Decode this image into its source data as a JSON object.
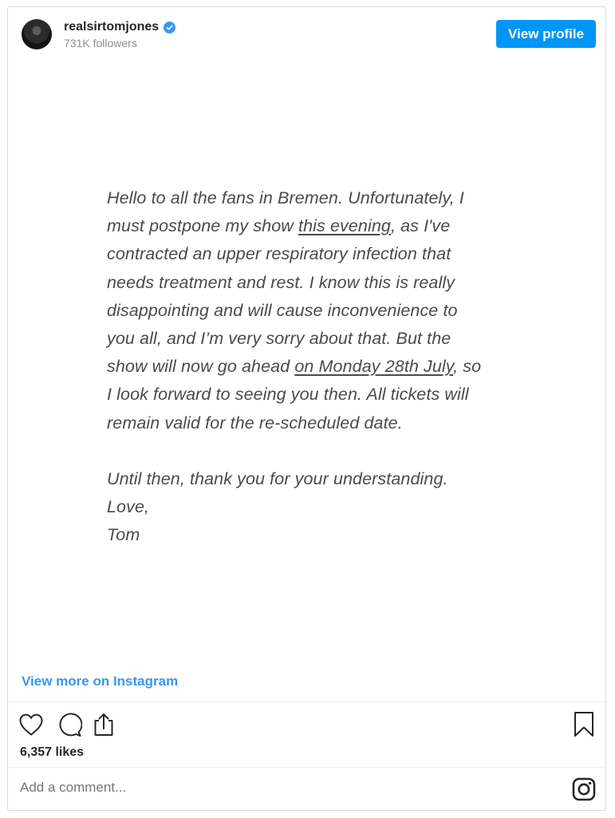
{
  "header": {
    "username": "realsirtomjones",
    "verified_icon": "verified-badge-icon",
    "followers": "731K followers",
    "view_profile_label": "View profile",
    "accent_color": "#0095f6"
  },
  "post": {
    "paragraph1_lines": [
      "Hello to all the fans in Bremen. Unfortunately, I",
      "must postpone my show this evening, as I've",
      "contracted an upper respiratory infection that",
      "needs treatment and rest. I know this is really",
      "disappointing and will cause inconvenience to",
      "you all, and I’m very sorry about that. But the",
      "show will now go ahead on Monday 28th July, so",
      "I look forward to seeing you then. All tickets will",
      "remain valid for the re-scheduled date."
    ],
    "line2_pre": "must postpone my show ",
    "line2_link": "this evening",
    "line2_post": ", as I've",
    "line7_pre": "show will now go ahead ",
    "line7_link": "on Monday 28th July",
    "line7_post": ", so",
    "closing_lines": [
      "Until then, thank you for your understanding.",
      "Love,",
      "Tom"
    ]
  },
  "links": {
    "view_more": "View more on Instagram"
  },
  "actions": {
    "icons": [
      "heart-icon",
      "comment-icon",
      "share-icon",
      "bookmark-icon"
    ],
    "likes": "6,357 likes"
  },
  "comment": {
    "placeholder": "Add a comment...",
    "icon": "instagram-icon"
  }
}
